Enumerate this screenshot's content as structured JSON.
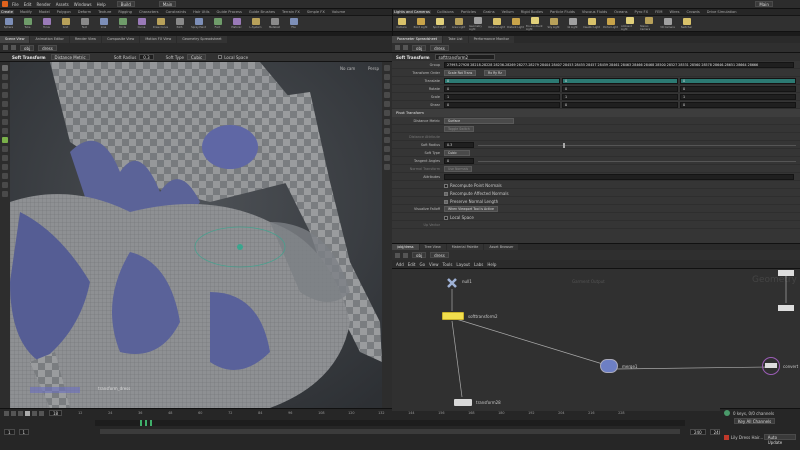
{
  "menubar": {
    "items": [
      "File",
      "Edit",
      "Render",
      "Assets",
      "Windows",
      "Help"
    ],
    "desktop": "Build",
    "context": "Main"
  },
  "shelf_left": {
    "tabs": [
      "Create",
      "Modify",
      "Model",
      "Polygon",
      "Deform",
      "Texture",
      "Rigging",
      "Characters",
      "Constraints",
      "Hair Utils",
      "Guide Process",
      "Guide Brushes",
      "Terrain FX",
      "Simple FX",
      "Volume"
    ],
    "tools": [
      "Sphere",
      "Tube",
      "Torus",
      "Grid",
      "Null",
      "Line",
      "Circle",
      "Curve",
      "Draw Curve",
      "Path",
      "Spray Paint",
      "Font",
      "Platonic",
      "L-System",
      "Metaball",
      "File"
    ]
  },
  "shelf_right": {
    "tabs": [
      "Lights and Cameras",
      "Collisions",
      "Particles",
      "Grains",
      "Vellum",
      "Rigid Bodies",
      "Particle Fluids",
      "Viscous Fluids",
      "Oceans",
      "Pyro FX",
      "FEM",
      "Wires",
      "Crowds",
      "Drive Simulation"
    ],
    "tools": [
      "Camera",
      "Point Light",
      "Spot Light",
      "Area Light",
      "Geometry Light",
      "Volume Light",
      "Distant Light",
      "Environment Light",
      "Sky Light",
      "GI Light",
      "Caustic Light",
      "Portal Light",
      "Ambient Light",
      "Stereo Camera",
      "VR Camera",
      "Switcher"
    ]
  },
  "viewport": {
    "tabs": [
      "Scene View",
      "Animation Editor",
      "Render View",
      "Composite View",
      "Motion FX View",
      "Geometry Spreadsheet"
    ],
    "path": "obj",
    "node": "dress",
    "tool_label": "Soft Transform",
    "tool_hint": "Distance Metric",
    "opts": [
      "Soft Radius",
      "0.3",
      "Soft Type",
      "Cubic",
      "Local Space"
    ],
    "camera": "Persp",
    "cam2": "No cam",
    "overlay": "transform_dress"
  },
  "params": {
    "tabs": [
      "Parameter Spreadsheet",
      "Take List",
      "Performance Monitor"
    ],
    "type": "Soft Transform",
    "name": "softtransform2",
    "group_label": "Group",
    "group_value": "27993-27928 28218-28228 28236-28269 28277-28279 28404 28407 28453 28455 28457 28459 28461 28463 28466 28468 28500 28527 28531 28560 28578 28646-28651 28664 28666",
    "order_label": "Transform Order",
    "order_value": "Scale Rot Trans",
    "rot_value": "Rx Ry Rz",
    "rows": [
      {
        "label": "Translate",
        "values": [
          "0",
          "0",
          "0"
        ]
      },
      {
        "label": "Rotate",
        "values": [
          "0",
          "0",
          "0"
        ]
      },
      {
        "label": "Scale",
        "values": [
          "1",
          "1",
          "1"
        ]
      },
      {
        "label": "Shear",
        "values": [
          "0",
          "0",
          "0"
        ]
      }
    ],
    "pivot_section": "Pivot Transform",
    "distance_label": "Distance Metric",
    "distance_value": "Surface",
    "toggle_label": "Toggle Switch",
    "dist_attr_label": "Distance Attribute",
    "radius_label": "Soft Radius",
    "radius_value": "0.3",
    "softtype_label": "Soft Type",
    "softtype_value": "Cubic",
    "tangent_label": "Tangent Angles",
    "tangent_value": "0",
    "normal_label": "Normal Transform",
    "normal_value": "Use Normals",
    "attributes_label": "Attributes",
    "checks": [
      "Recompute Point Normals",
      "Recompute Affected Normals",
      "Preserve Normal Length"
    ],
    "visualize_label": "Visualize Falloff",
    "visualize_value": "When Viewport Tool is Active",
    "local_label": "Local Space",
    "up_label": "Up Vector"
  },
  "network": {
    "tabs": [
      "/obj/dress",
      "Tree View",
      "Material Palette",
      "Asset Browser"
    ],
    "path": "obj",
    "node": "dress",
    "menu": [
      "Add",
      "Edit",
      "Go",
      "View",
      "Tools",
      "Layout",
      "Labs",
      "Help"
    ],
    "watermark": "Geometry",
    "area_label": "Garment Output",
    "nodes": [
      "null1",
      "softtransform2",
      "merge1",
      "transform28",
      "convert"
    ]
  },
  "timeline": {
    "frame": "18",
    "start": "1",
    "start2": "1",
    "end": "240",
    "end2": "240",
    "ticks": [
      "12",
      "24",
      "36",
      "48",
      "60",
      "72",
      "84",
      "96",
      "108",
      "120",
      "132",
      "144",
      "156",
      "168",
      "180",
      "192",
      "204",
      "216",
      "228"
    ]
  },
  "status": {
    "keys": "0 keys, 0/0 channels",
    "key_all": "Key All Channels",
    "update": "Auto Update",
    "message": "Lily Dress Hair..."
  },
  "colors": {
    "accent": "#e0631d",
    "selected": "#f2df4d",
    "teal": "#2c7a73",
    "node_blue": "#6d7fc4",
    "node_purple": "#9a5cb5"
  }
}
